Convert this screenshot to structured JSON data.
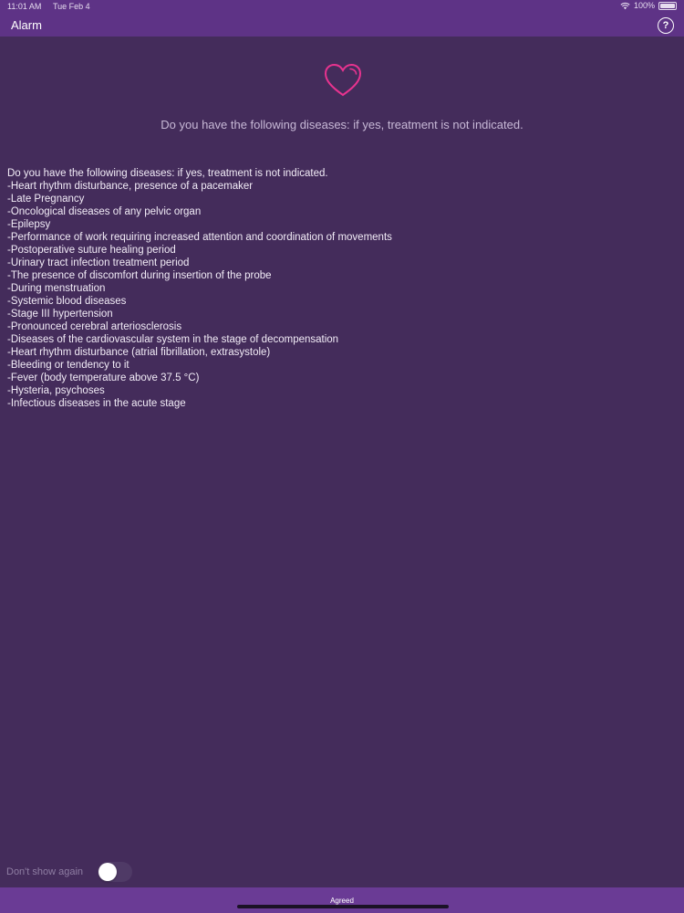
{
  "status_bar": {
    "time": "11:01 AM",
    "date": "Tue Feb 4",
    "battery": "100%"
  },
  "nav": {
    "title": "Alarm",
    "help_label": "?"
  },
  "main": {
    "heart_icon": "heart-icon",
    "headline": "Do you have the following diseases: if yes, treatment is not indicated.",
    "lines": [
      "Do you have the following diseases: if yes, treatment is not indicated.",
      "-Heart rhythm disturbance, presence of a pacemaker",
      "-Late Pregnancy",
      "-Oncological diseases of any pelvic organ",
      "-Epilepsy",
      "-Performance of work requiring increased attention and coordination of movements",
      "-Postoperative suture healing period",
      "-Urinary tract infection treatment period",
      "-The presence of discomfort during insertion of the probe",
      "-During menstruation",
      "-Systemic blood diseases",
      "-Stage III hypertension",
      "-Pronounced cerebral arteriosclerosis",
      "-Diseases of the cardiovascular system in the stage of decompensation",
      "-Heart rhythm disturbance (atrial fibrillation, extrasystole)",
      "-Bleeding or tendency to it",
      "-Fever (body temperature above 37.5 °C)",
      "-Hysteria, psychoses",
      "-Infectious diseases in the acute stage"
    ]
  },
  "footer": {
    "dont_show_label": "Don't show again",
    "dont_show_on": false,
    "agreed_label": "Agreed"
  },
  "colors": {
    "background": "#442c5b",
    "bar": "#5e3386",
    "accent_heart": "#e8338f"
  }
}
